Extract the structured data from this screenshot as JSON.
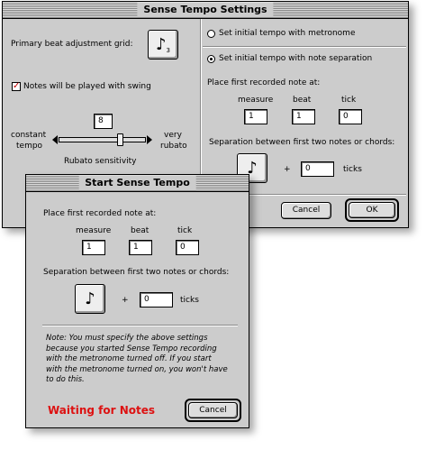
{
  "settings_window": {
    "title": "Sense Tempo Settings",
    "primary_beat_label": "Primary beat adjustment grid:",
    "primary_beat_note": "♪",
    "primary_beat_subscript": "3",
    "swing_checked": true,
    "swing_check_mark": "✓",
    "swing_label": "Notes will be played with swing",
    "rubato_value": "8",
    "rubato_left_line1": "constant",
    "rubato_left_line2": "tempo",
    "rubato_right_line1": "very",
    "rubato_right_line2": "rubato",
    "rubato_caption": "Rubato sensitivity",
    "rubato_level_fraction": 0.72,
    "radio_metronome_label": "Set initial tempo with metronome",
    "radio_metronome_selected": false,
    "radio_separation_label": "Set initial tempo with note separation",
    "radio_separation_selected": true,
    "place_first_label": "Place first recorded note at:",
    "col_measure": "measure",
    "col_beat": "beat",
    "col_tick": "tick",
    "measure_value": "1",
    "beat_value": "1",
    "tick_value": "0",
    "separation_label": "Separation between first two notes or chords:",
    "separation_note": "♪",
    "plus": "+",
    "ticks_value": "0",
    "ticks_label": "ticks",
    "cancel_label": "Cancel",
    "ok_label": "OK"
  },
  "start_window": {
    "title": "Start Sense Tempo",
    "place_first_label": "Place first recorded note at:",
    "col_measure": "measure",
    "col_beat": "beat",
    "col_tick": "tick",
    "measure_value": "1",
    "beat_value": "1",
    "tick_value": "0",
    "separation_label": "Separation between first two notes or chords:",
    "separation_note": "♪",
    "plus": "+",
    "ticks_value": "0",
    "ticks_label": "ticks",
    "note_line1": "Note:  You must specify the above settings",
    "note_line2": "because you started Sense Tempo recording",
    "note_line3": "with the metronome turned off.  If you start",
    "note_line4": "with the metronome turned on, you won't have",
    "note_line5": "to do this.",
    "status": "Waiting for Notes",
    "cancel_label": "Cancel"
  },
  "colors": {
    "window_bg": "#cccccc",
    "status_red": "#dd1111",
    "check_red": "#c00000"
  }
}
